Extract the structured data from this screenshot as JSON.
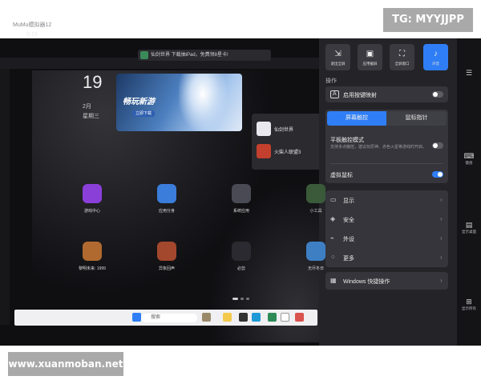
{
  "watermarks": {
    "top": "TG: MYYJJPP",
    "bottom": "www.xuanmoban.net"
  },
  "emulator": {
    "title": "MuMu模拟器12",
    "time": "5:19"
  },
  "notice": {
    "text": "仙剑世界  下载抽iPad，免费领8星卡!"
  },
  "date": {
    "day": "19",
    "month": "2月",
    "weekday": "星期三"
  },
  "banner": {
    "title": "畅玩新游",
    "button": "立即下载"
  },
  "game_card": {
    "items": [
      "仙剑世界",
      "火柴人联盟3"
    ]
  },
  "apps": [
    {
      "label": "游戏中心",
      "color": "#8b3fd9"
    },
    {
      "label": "应用分身",
      "color": "#3b7ddb"
    },
    {
      "label": "系统应用",
      "color": "#4a4a55"
    },
    {
      "label": "小工具",
      "color": "#3a5a3a"
    },
    {
      "label": "黎明未来: 1999",
      "color": "#b06a30"
    },
    {
      "label": "异象回声",
      "color": "#a3472d"
    },
    {
      "label": "必剪",
      "color": "#2a2a30"
    },
    {
      "label": "无尽冬日",
      "color": "#3e7fc4"
    }
  ],
  "taskbar": {
    "search_placeholder": "搜索"
  },
  "panel": {
    "quick_buttons": [
      {
        "label": "退出全屏",
        "icon": "exit-fullscreen-icon",
        "glyph": "⇲",
        "active": false
      },
      {
        "label": "应用截屏",
        "icon": "screenshot-icon",
        "glyph": "▣",
        "active": false
      },
      {
        "label": "全屏窗口",
        "icon": "fullscreen-icon",
        "glyph": "⛶",
        "active": false
      },
      {
        "label": "声音",
        "icon": "speaker-icon",
        "glyph": "♪",
        "active": true
      }
    ],
    "section_label": "操作",
    "keymap": {
      "icon": "A",
      "label": "启用按键映射",
      "enabled": false
    },
    "tabs": [
      {
        "label": "屏幕触控",
        "active": true
      },
      {
        "label": "鼠标指针",
        "active": false
      }
    ],
    "tablet_mode": {
      "label": "平板触控模式",
      "desc": "支持多点触控，建议玩原神、赤色火星等游戏时开启。",
      "enabled": false
    },
    "virtual_mouse": {
      "label": "虚拟鼠标",
      "enabled": true
    },
    "menu": [
      {
        "label": "显示",
        "icon": "display-icon",
        "glyph": "▭"
      },
      {
        "label": "安全",
        "icon": "shield-icon",
        "glyph": "◈"
      },
      {
        "label": "外设",
        "icon": "peripheral-icon",
        "glyph": "⌁"
      },
      {
        "label": "更多",
        "icon": "more-icon",
        "glyph": "⁘"
      }
    ],
    "windows_shortcut": {
      "label": "Windows 快捷操作",
      "glyph": "▦"
    }
  },
  "right_strip": [
    {
      "label": "",
      "glyph": "☰",
      "icon": "menu-icon"
    },
    {
      "label": "键盘",
      "glyph": "⌨",
      "icon": "keyboard-icon"
    },
    {
      "label": "显示桌面",
      "glyph": "▤",
      "icon": "show-desktop-icon"
    },
    {
      "label": "显示所有",
      "glyph": "⊞",
      "icon": "show-all-icon"
    }
  ]
}
